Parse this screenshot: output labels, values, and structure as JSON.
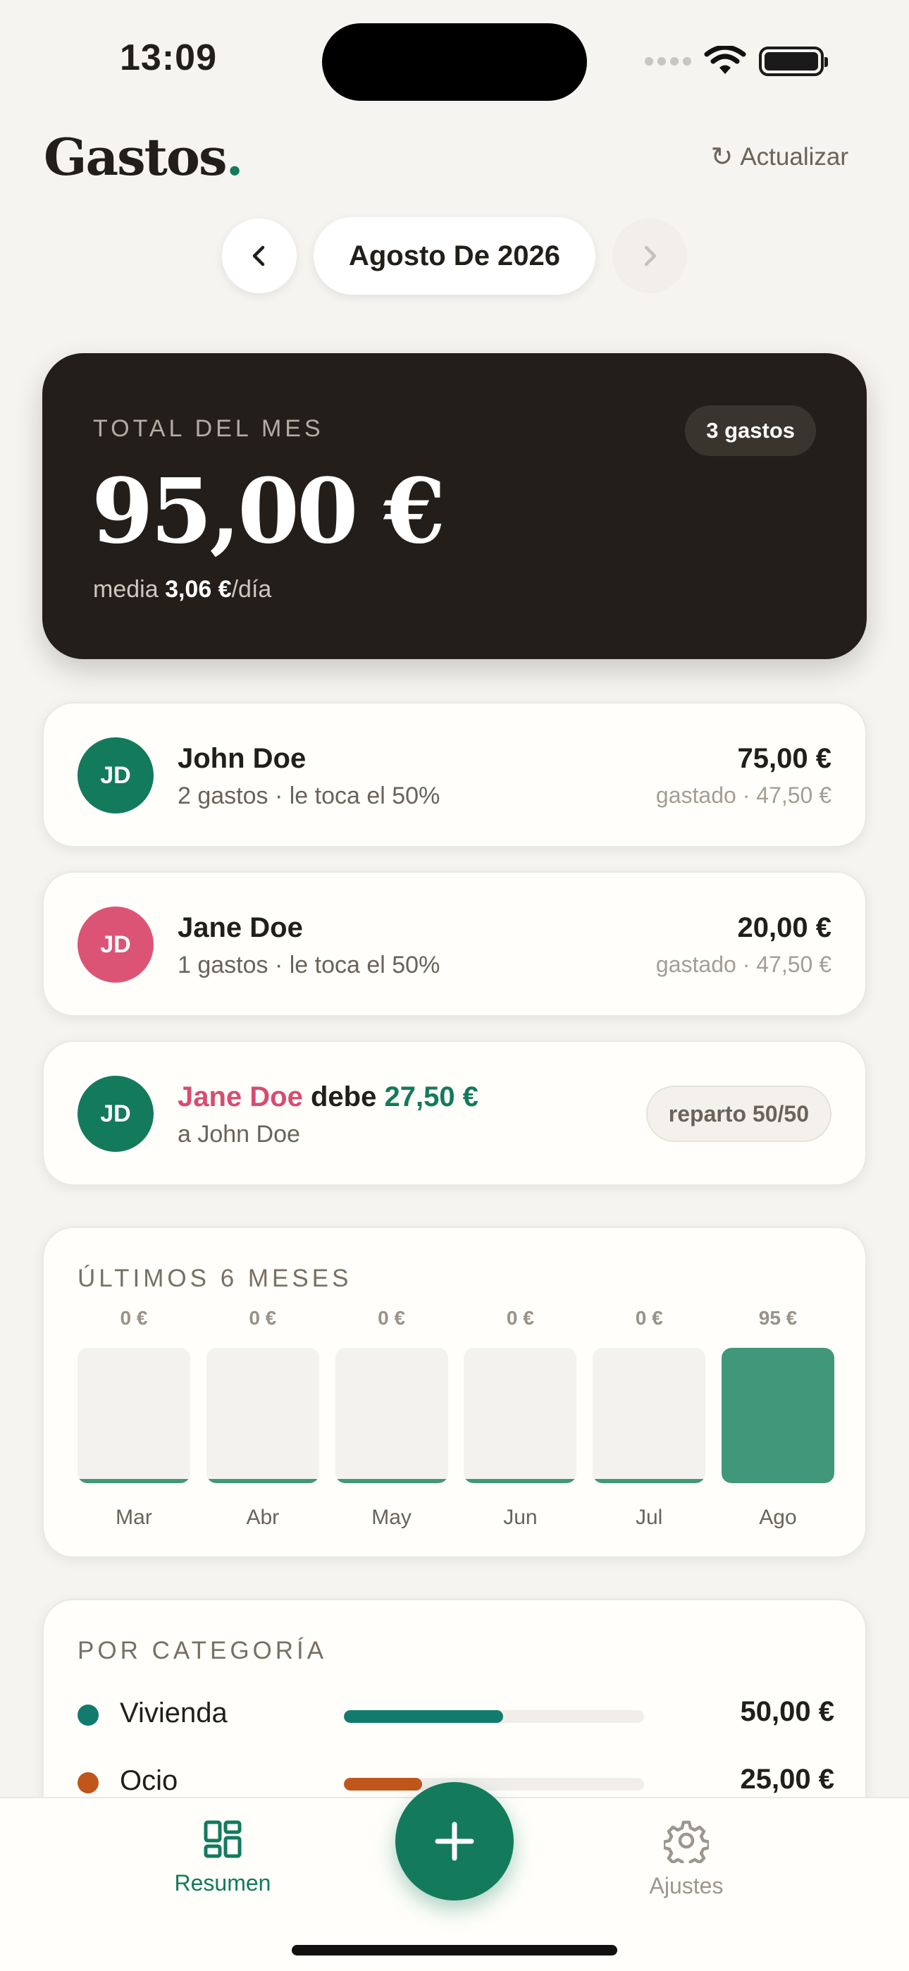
{
  "status": {
    "time": "13:09"
  },
  "header": {
    "brand": "Gastos",
    "brand_dot": ".",
    "refresh_label": "Actualizar"
  },
  "month_nav": {
    "label": "Agosto De 2026"
  },
  "total": {
    "label": "TOTAL DEL MES",
    "count_badge": "3 gastos",
    "amount": "95,00 €",
    "avg_prefix": "media ",
    "avg_value": "3,06 €",
    "avg_suffix": "/día"
  },
  "people": [
    {
      "initials": "JD",
      "name": "John Doe",
      "sub": "2 gastos · le toca el 50%",
      "amount": "75,00 €",
      "spent": "gastado · 47,50 €",
      "color": "#137a5c"
    },
    {
      "initials": "JD",
      "name": "Jane Doe",
      "sub": "1 gastos · le toca el 50%",
      "amount": "20,00 €",
      "spent": "gastado · 47,50 €",
      "color": "#db5476"
    }
  ],
  "debt": {
    "initials": "JD",
    "debtor": "Jane Doe",
    "verb": "debe",
    "amount": "27,50 €",
    "to": "a John Doe",
    "split_label": "reparto 50/50"
  },
  "chart_data": {
    "type": "bar",
    "title": "ÚLTIMOS 6 MESES",
    "categories": [
      "Mar",
      "Abr",
      "May",
      "Jun",
      "Jul",
      "Ago"
    ],
    "values": [
      0,
      0,
      0,
      0,
      0,
      95
    ],
    "value_labels": [
      "0 €",
      "0 €",
      "0 €",
      "0 €",
      "0 €",
      "95 €"
    ],
    "ylim": [
      0,
      95
    ],
    "bar_color": "#419779"
  },
  "categories_section": {
    "title": "POR CATEGORÍA",
    "items": [
      {
        "name": "Vivienda",
        "amount": "50,00 €",
        "share": 0.53,
        "color": "#137a6e"
      },
      {
        "name": "Ocio",
        "amount": "25,00 €",
        "share": 0.26,
        "color": "#c0561b"
      }
    ]
  },
  "tabbar": {
    "summary_label": "Resumen",
    "settings_label": "Ajustes",
    "add_icon": "plus-icon"
  }
}
